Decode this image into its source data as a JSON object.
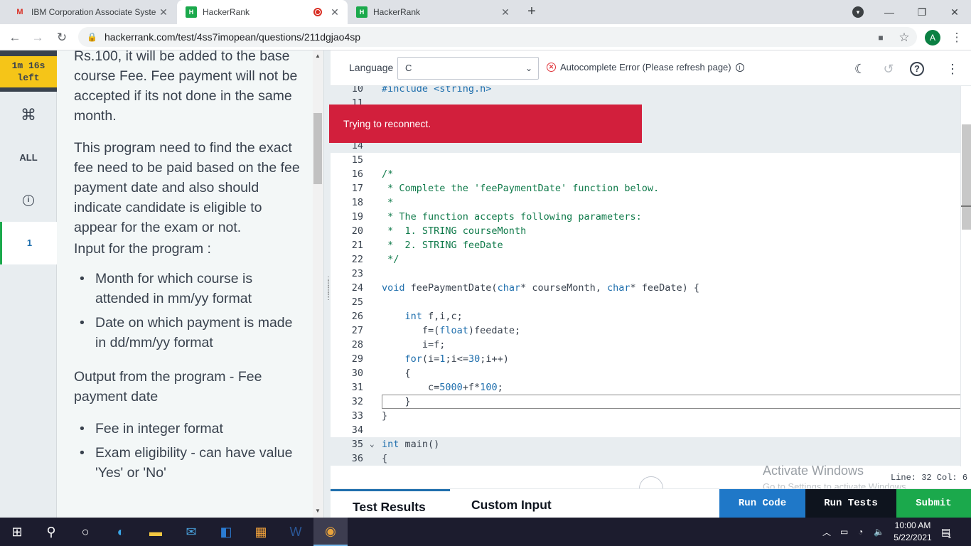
{
  "browser": {
    "tabs": [
      {
        "title": "IBM Corporation Associate Syste",
        "favicon": "gmail-icon"
      },
      {
        "title": "HackerRank",
        "favicon": "hackerrank-icon",
        "recording": true
      },
      {
        "title": "HackerRank",
        "favicon": "hackerrank-icon"
      }
    ],
    "url": "hackerrank.com/test/4ss7imopean/questions/211dgjao4sp",
    "profile_initial": "A"
  },
  "sidenav": {
    "timer_line1": "1m 16s",
    "timer_line2": "left",
    "cmd_symbol": "⌘",
    "all_label": "ALL",
    "info_symbol": "i",
    "question_number": "1"
  },
  "problem": {
    "p1": "Rs.100, it will be added to the base course Fee. Fee payment will not be accepted if its not done in the same month.",
    "p2": "This program need to find the exact fee need to be paid based on the fee payment date and also should indicate candidate is eligible to appear for the exam or not.",
    "p3": "Input for the program :",
    "input_items": [
      "Month for which course is attended in mm/yy format",
      "Date on which payment is made in dd/mm/yy format"
    ],
    "p4": "Output from the program - Fee payment date",
    "output_items": [
      "Fee in integer format",
      "Exam eligibility - can have value  'Yes' or  'No'"
    ]
  },
  "editor": {
    "language_label": "Language",
    "language_value": "C",
    "autocomplete_error": "Autocomplete Error (Please refresh page)",
    "toast": "Trying to reconnect.",
    "status": "Line: 32 Col: 6",
    "watermark_title": "Activate Windows",
    "watermark_sub": "Go to Settings to activate Windows.",
    "lines": [
      {
        "n": "10",
        "text": "#include <string.h>"
      },
      {
        "n": "11",
        "text": ""
      },
      {
        "n": "14",
        "text": ""
      },
      {
        "n": "15",
        "text": ""
      },
      {
        "n": "16",
        "text": "/*"
      },
      {
        "n": "17",
        "text": " * Complete the 'feePaymentDate' function below."
      },
      {
        "n": "18",
        "text": " *"
      },
      {
        "n": "19",
        "text": " * The function accepts following parameters:"
      },
      {
        "n": "20",
        "text": " *  1. STRING courseMonth"
      },
      {
        "n": "21",
        "text": " *  2. STRING feeDate"
      },
      {
        "n": "22",
        "text": " */"
      },
      {
        "n": "23",
        "text": ""
      },
      {
        "n": "24",
        "text": "void feePaymentDate(char* courseMonth, char* feeDate) {"
      },
      {
        "n": "25",
        "text": ""
      },
      {
        "n": "26",
        "text": "    int f,i,c;"
      },
      {
        "n": "27",
        "text": "       f=(float)feedate;"
      },
      {
        "n": "28",
        "text": "       i=f;"
      },
      {
        "n": "29",
        "text": "    for(i=1;i<=30;i++)"
      },
      {
        "n": "30",
        "text": "    {"
      },
      {
        "n": "31",
        "text": "        c=5000+f*100;"
      },
      {
        "n": "32",
        "text": "    }"
      },
      {
        "n": "33",
        "text": "}"
      },
      {
        "n": "34",
        "text": ""
      },
      {
        "n": "35",
        "text": "int main()"
      },
      {
        "n": "36",
        "text": "{"
      }
    ]
  },
  "bottom": {
    "tab_results": "Test Results",
    "tab_custom": "Custom Input",
    "run_code": "Run Code",
    "run_tests": "Run Tests",
    "submit": "Submit"
  },
  "taskbar": {
    "time": "10:00 AM",
    "date": "5/22/2021",
    "notification_count": "1"
  },
  "colors": {
    "accent_green": "#1ba94c",
    "accent_blue": "#1f6fad",
    "toast_red": "#d21f3c",
    "timer_yellow": "#f5c518"
  }
}
